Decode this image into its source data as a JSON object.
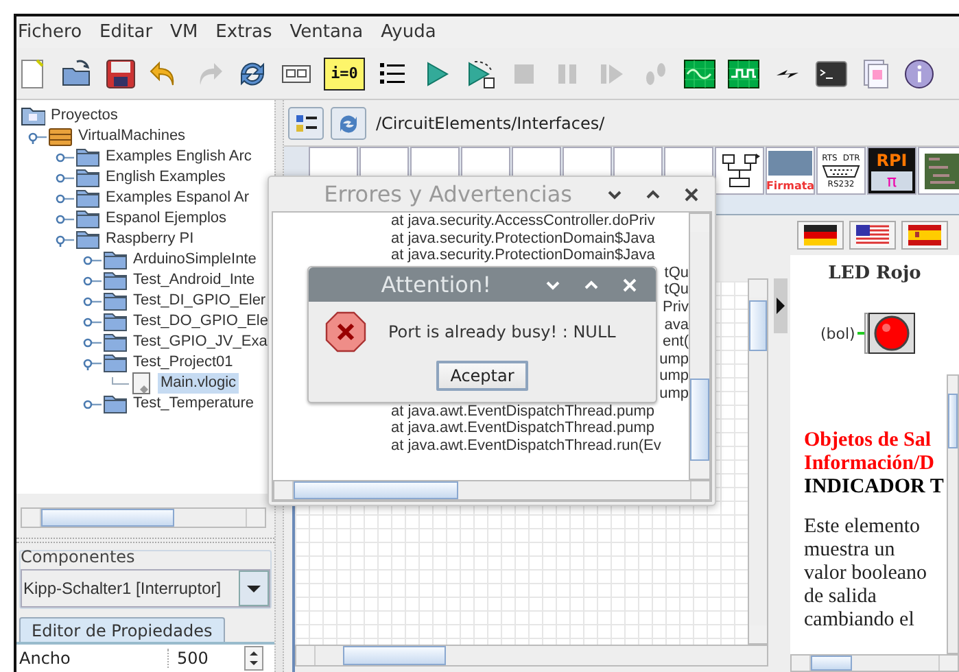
{
  "menu": [
    "Fichero",
    "Editar",
    "VM",
    "Extras",
    "Ventana",
    "Ayuda"
  ],
  "toolbar": [
    {
      "kind": "new",
      "disabled": false
    },
    {
      "kind": "open",
      "disabled": false
    },
    {
      "kind": "save",
      "disabled": false
    },
    {
      "kind": "undo",
      "disabled": false
    },
    {
      "kind": "redo",
      "disabled": true
    },
    {
      "kind": "refresh",
      "disabled": false
    },
    {
      "kind": "panel",
      "disabled": false
    },
    {
      "kind": "counter",
      "label": "i=0",
      "disabled": false
    },
    {
      "kind": "list",
      "disabled": false
    },
    {
      "kind": "play",
      "disabled": false
    },
    {
      "kind": "play-step",
      "disabled": false
    },
    {
      "kind": "stop",
      "disabled": true
    },
    {
      "kind": "pause",
      "disabled": true
    },
    {
      "kind": "step",
      "disabled": true
    },
    {
      "kind": "steps",
      "disabled": true
    },
    {
      "kind": "scope",
      "disabled": false
    },
    {
      "kind": "analyzer",
      "disabled": false
    },
    {
      "kind": "spark",
      "disabled": false
    },
    {
      "kind": "console",
      "disabled": false
    },
    {
      "kind": "stack",
      "disabled": false
    },
    {
      "kind": "info",
      "disabled": false
    }
  ],
  "tree": [
    {
      "label": "Proyectos",
      "kind": "root",
      "selected": false,
      "children": [
        {
          "label": "VirtualMachines",
          "kind": "vm",
          "selected": false,
          "children": [
            {
              "label": "Examples English Arc",
              "kind": "folder",
              "selected": false
            },
            {
              "label": "English Examples",
              "kind": "folder",
              "selected": false
            },
            {
              "label": "Examples Espanol Ar",
              "kind": "folder",
              "selected": false
            },
            {
              "label": "Espanol Ejemplos",
              "kind": "folder",
              "selected": false
            },
            {
              "label": "Raspberry PI",
              "kind": "folder",
              "selected": false,
              "children": [
                {
                  "label": "ArduinoSimpleInte",
                  "kind": "folder",
                  "selected": false
                },
                {
                  "label": "Test_Android_Inte",
                  "kind": "folder",
                  "selected": false
                },
                {
                  "label": "Test_DI_GPIO_Eler",
                  "kind": "folder",
                  "selected": false
                },
                {
                  "label": "Test_DO_GPIO_Ele",
                  "kind": "folder",
                  "selected": false
                },
                {
                  "label": "Test_GPIO_JV_Exa",
                  "kind": "folder",
                  "selected": false
                },
                {
                  "label": "Test_Project01",
                  "kind": "folder",
                  "selected": false,
                  "children": [
                    {
                      "label": "Main.vlogic",
                      "kind": "file",
                      "selected": true
                    }
                  ]
                },
                {
                  "label": "Test_Temperature",
                  "kind": "folder",
                  "selected": false
                }
              ]
            }
          ]
        }
      ]
    }
  ],
  "components": {
    "title": "Componentes",
    "value": "Kipp-Schalter1 [Interruptor]"
  },
  "properties": {
    "tabs": [
      {
        "label": "Editor de Propiedades",
        "selected": true
      }
    ],
    "rows": [
      {
        "name": "Ancho",
        "value": "500"
      }
    ]
  },
  "path": "/CircuitElements/Interfaces/",
  "palette": [
    {
      "kind": "covered"
    },
    {
      "kind": "covered"
    },
    {
      "kind": "covered"
    },
    {
      "kind": "covered"
    },
    {
      "kind": "covered"
    },
    {
      "kind": "covered"
    },
    {
      "kind": "covered"
    },
    {
      "kind": "covered"
    },
    {
      "kind": "network"
    },
    {
      "kind": "firmata",
      "texts": [
        "Firmata"
      ]
    },
    {
      "kind": "rs232",
      "texts": [
        "RTS",
        "DTR",
        "RS232"
      ]
    },
    {
      "kind": "rpi",
      "texts": [
        "RPI",
        "π"
      ]
    },
    {
      "kind": "board"
    }
  ],
  "help": {
    "flags": [
      {
        "kind": "de"
      },
      {
        "kind": "us"
      },
      {
        "kind": "es"
      }
    ],
    "title": "LED Rojo",
    "pin": "(bol)",
    "paragraphs": [
      {
        "kind": "red",
        "text": "Objetos de Sal"
      },
      {
        "kind": "red",
        "text": "Información/D"
      },
      {
        "kind": "heading",
        "text": "INDICADOR T"
      },
      {
        "kind": "body",
        "text": "Este elemento muestra un valor booleano de salida cambiando el"
      }
    ]
  },
  "errors_window": {
    "title": "Errores y Advertencias",
    "lines": [
      {
        "kind": "line",
        "text": "at java.security.AccessController.doPriv"
      },
      {
        "kind": "line",
        "text": "at java.security.ProtectionDomain$Java"
      },
      {
        "kind": "line",
        "text": "at java.security.ProtectionDomain$Java"
      },
      {
        "kind": "tail",
        "text": "tQu"
      },
      {
        "kind": "tail",
        "text": "tQu"
      },
      {
        "kind": "tail",
        "text": "Priv"
      },
      {
        "kind": "tail",
        "text": "ava"
      },
      {
        "kind": "tail",
        "text": "ent("
      },
      {
        "kind": "tail",
        "text": "ump"
      },
      {
        "kind": "tail",
        "text": "ump"
      },
      {
        "kind": "tail",
        "text": "ump"
      },
      {
        "kind": "line",
        "text": "at java.awt.EventDispatchThread.pump"
      },
      {
        "kind": "line",
        "text": "at java.awt.EventDispatchThread.pump"
      },
      {
        "kind": "line",
        "text": "at java.awt.EventDispatchThread.run(Ev"
      }
    ]
  },
  "dialog": {
    "title": "Attention!",
    "message": "Port is already busy! : NULL",
    "button": "Aceptar"
  }
}
